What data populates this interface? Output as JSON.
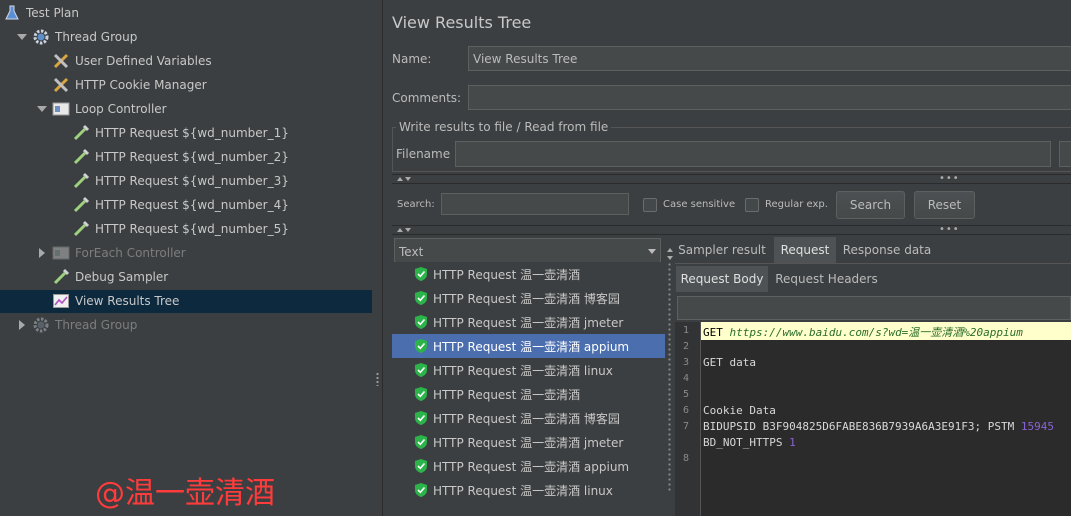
{
  "tree": {
    "test_plan": "Test Plan",
    "thread_group": "Thread Group",
    "user_defined_variables": "User Defined Variables",
    "http_cookie_manager": "HTTP Cookie Manager",
    "loop_controller": "Loop Controller",
    "http_requests": [
      "HTTP Request ${wd_number_1}",
      "HTTP Request ${wd_number_2}",
      "HTTP Request ${wd_number_3}",
      "HTTP Request ${wd_number_4}",
      "HTTP Request ${wd_number_5}"
    ],
    "foreach_controller": "ForEach Controller",
    "debug_sampler": "Debug Sampler",
    "view_results_tree": "View Results Tree",
    "thread_group_2": "Thread Group"
  },
  "panel": {
    "title": "View Results Tree",
    "name_label": "Name:",
    "name_value": "View Results Tree",
    "comments_label": "Comments:",
    "comments_value": "",
    "write_results_legend": "Write results to file / Read from file",
    "filename_label": "Filename",
    "filename_value": ""
  },
  "search": {
    "label": "Search:",
    "value": "",
    "case_sensitive": "Case sensitive",
    "regular_exp": "Regular exp.",
    "search_button": "Search",
    "reset_button": "Reset"
  },
  "renderer": {
    "selected": "Text"
  },
  "results": [
    "HTTP Request 温一壶清酒",
    "HTTP Request 温一壶清酒 博客园",
    "HTTP Request 温一壶清酒 jmeter",
    "HTTP Request 温一壶清酒 appium",
    "HTTP Request 温一壶清酒 linux",
    "HTTP Request 温一壶清酒",
    "HTTP Request 温一壶清酒 博客园",
    "HTTP Request 温一壶清酒 jmeter",
    "HTTP Request 温一壶清酒 appium",
    "HTTP Request 温一壶清酒 linux"
  ],
  "selected_result_index": 3,
  "tabs": {
    "sampler_result": "Sampler result",
    "request": "Request",
    "response_data": "Response data"
  },
  "subtabs": {
    "request_body": "Request Body",
    "request_headers": "Request Headers"
  },
  "request_body": {
    "line1_method": "GET ",
    "line1_url": "https://www.baidu.com/s?wd=温一壶清酒%20appium",
    "line3": "GET data",
    "line6": "Cookie Data",
    "line7": "BIDUPSID B3F904825D6FABE836B7939A6A3E91F3; PSTM",
    "line7_tail": "15945",
    "line7b": "BD_NOT_HTTPS",
    "line7b_tail": "1",
    "line_numbers": [
      "1",
      "2",
      "3",
      "4",
      "5",
      "6",
      "7",
      "8"
    ]
  },
  "watermark": "@温一壶清酒",
  "colors": {
    "background": "#3c3f41",
    "selection_tree": "#0d293e",
    "selection_list": "#4b6eaf",
    "pass_icon": "#2cb34a",
    "highlight_line": "#ffffcc",
    "watermark": "#ff3b3b"
  }
}
